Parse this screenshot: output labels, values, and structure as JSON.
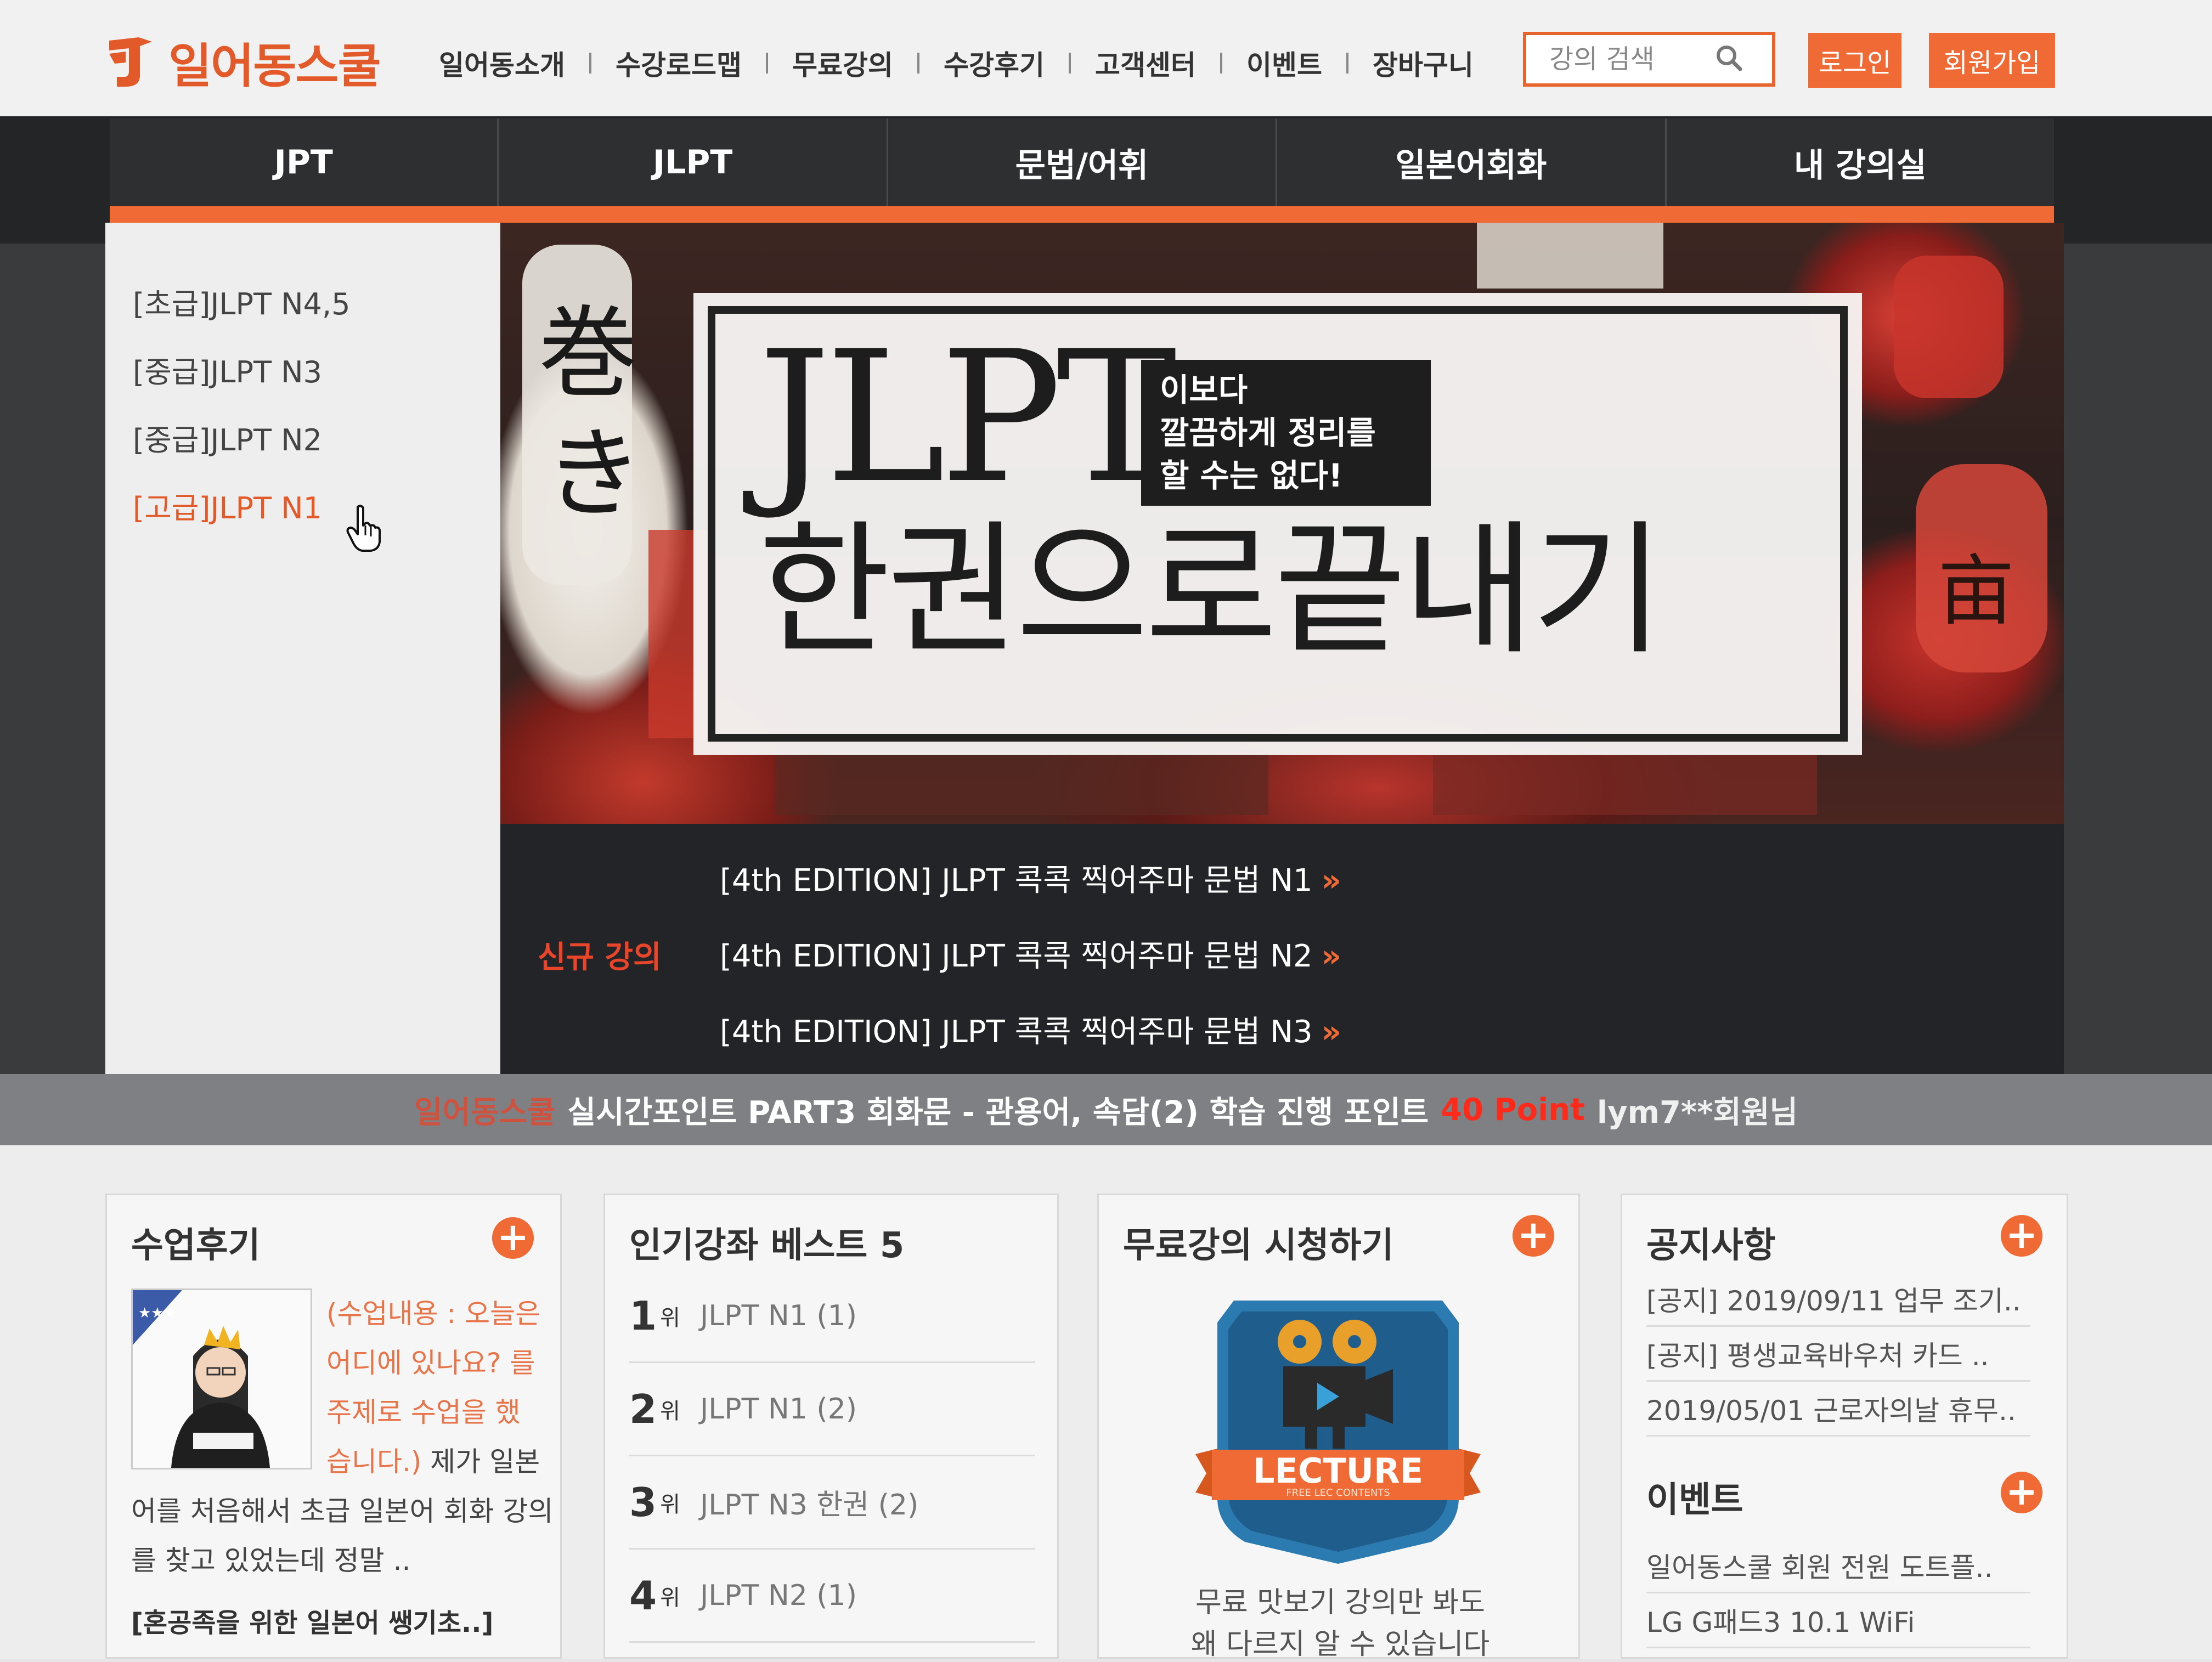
{
  "brand": {
    "name": "일어동스쿨",
    "accent_color": "#ef6a34"
  },
  "gnb": {
    "items": [
      "일어동소개",
      "수강로드맵",
      "무료강의",
      "수강후기",
      "고객센터",
      "이벤트",
      "장바구니"
    ]
  },
  "search": {
    "placeholder": "강의 검색",
    "icon": "search-icon"
  },
  "auth": {
    "login_label": "로그인",
    "join_label": "회원가입"
  },
  "main_nav": {
    "items": [
      "JPT",
      "JLPT",
      "문법/어휘",
      "일본어회화",
      "내 강의실"
    ]
  },
  "submenu": {
    "items": [
      "[초급]JLPT N4,5",
      "[중급]JLPT N3",
      "[중급]JLPT N2",
      "[고급]JLPT N1"
    ],
    "active_index": 3
  },
  "hero": {
    "title": "JLPT",
    "tag_lines": [
      "이보다",
      "깔끔하게 정리를",
      "할 수는 없다!"
    ],
    "subtitle": "한권으로끝내기"
  },
  "new_lectures": {
    "label": "신규 강의",
    "items": [
      "[4th EDITION] JLPT 콕콕 찍어주마 문법 N1",
      "[4th EDITION] JLPT 콕콕 찍어주마 문법 N2",
      "[4th EDITION] JLPT 콕콕 찍어주마 문법 N3"
    ],
    "arrow": "»"
  },
  "ticker": {
    "brand": "일어동스쿨",
    "text": "실시간포인트 PART3 회화문 - 관용어, 속담(2) 학습 진행 포인트",
    "point": "40 Point",
    "user": "lym7**회원님"
  },
  "review": {
    "title": "수업후기",
    "plus": "+",
    "lines_orange": [
      "(수업내용 : 오늘은",
      "어디에 있나요? 를",
      "주제로 수업을 했"
    ],
    "line4_orange": "습니다.)",
    "line4_rest": " 제가 일본",
    "lines_rest": [
      "어를 처음해서 초급 일본어 회화 강의",
      "를 찾고 있었는데 정말 .."
    ],
    "footer": "[혼공족을 위한 일본어 쌩기초..]"
  },
  "best": {
    "title": "인기강좌 베스트 5",
    "rank_suffix": "위",
    "items": [
      {
        "rank": "1",
        "name": "JLPT N1 (1)"
      },
      {
        "rank": "2",
        "name": "JLPT N1 (2)"
      },
      {
        "rank": "3",
        "name": "JLPT N3 한권 (2)"
      },
      {
        "rank": "4",
        "name": "JLPT N2 (1)"
      }
    ]
  },
  "free": {
    "title": "무료강의 시청하기",
    "plus": "+",
    "badge_text": "LECTURE",
    "badge_sub": "FREE LEC CONTENTS",
    "lines": [
      "무료 맛보기 강의만 봐도",
      "왜 다르지 알 수 있습니다"
    ]
  },
  "notice": {
    "title": "공지사항",
    "plus": "+",
    "items": [
      "[공지] 2019/09/11 업무 조기..",
      "[공지] 평생교육바우처 카드 ..",
      "2019/05/01 근로자의날 휴무.."
    ]
  },
  "event": {
    "title": "이벤트",
    "plus": "+",
    "items": [
      "일어동스쿨 회원 전원 도트플..",
      "LG G패드3 10.1 WiFi"
    ]
  }
}
